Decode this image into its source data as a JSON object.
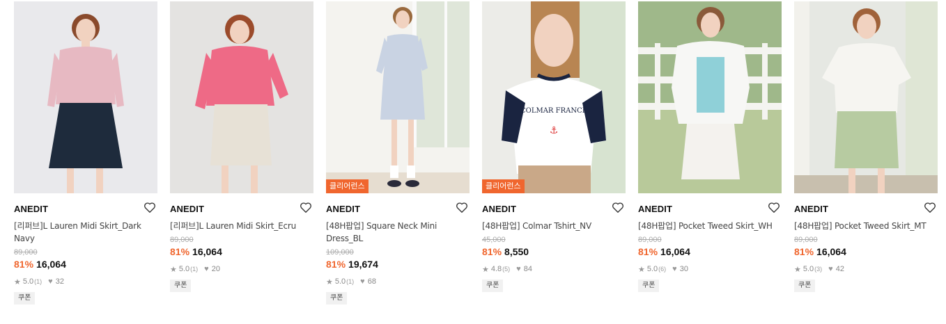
{
  "products": [
    {
      "brand": "ANEDIT",
      "name": "[리퍼브]L Lauren Midi Skirt_Dark Navy",
      "original_price": "89,000",
      "discount": "81%",
      "price": "16,064",
      "rating": "5.0",
      "reviews": "(1)",
      "likes": "32",
      "coupon": "쿠폰",
      "badge": "",
      "colors": {
        "bg": "#e9e9ec",
        "top": "#e7b9c2",
        "bottom": "#1e2b3c"
      }
    },
    {
      "brand": "ANEDIT",
      "name": "[리퍼브]L Lauren Midi Skirt_Ecru",
      "original_price": "89,000",
      "discount": "81%",
      "price": "16,064",
      "rating": "5.0",
      "reviews": "(1)",
      "likes": "20",
      "coupon": "쿠폰",
      "badge": "",
      "colors": {
        "bg": "#e4e3e1",
        "top": "#ee6a86",
        "bottom": "#e7e1d6"
      }
    },
    {
      "brand": "ANEDIT",
      "name": "[48H팝업] Square Neck Mini Dress_BL",
      "original_price": "109,000",
      "discount": "81%",
      "price": "19,674",
      "rating": "5.0",
      "reviews": "(1)",
      "likes": "68",
      "coupon": "쿠폰",
      "badge": "클리어런스",
      "colors": {
        "bg": "#dfe6d9",
        "top": "#c9d3e3",
        "bottom": "#c9d3e3"
      }
    },
    {
      "brand": "ANEDIT",
      "name": "[48H팝업] Colmar Tshirt_NV",
      "original_price": "45,000",
      "discount": "81%",
      "price": "8,550",
      "rating": "4.8",
      "reviews": "(5)",
      "likes": "84",
      "coupon": "쿠폰",
      "badge": "클리어런스",
      "colors": {
        "bg": "#d7e3d0",
        "top": "#ffffff",
        "bottom": "#c9a888"
      }
    },
    {
      "brand": "ANEDIT",
      "name": "[48H팝업] Pocket Tweed Skirt_WH",
      "original_price": "89,000",
      "discount": "81%",
      "price": "16,064",
      "rating": "5.0",
      "reviews": "(6)",
      "likes": "30",
      "coupon": "쿠폰",
      "badge": "",
      "colors": {
        "bg": "#b8c99a",
        "top": "#f7f7f5",
        "bottom": "#f4f2ee"
      }
    },
    {
      "brand": "ANEDIT",
      "name": "[48H팝업] Pocket Tweed Skirt_MT",
      "original_price": "89,000",
      "discount": "81%",
      "price": "16,064",
      "rating": "5.0",
      "reviews": "(3)",
      "likes": "42",
      "coupon": "쿠폰",
      "badge": "",
      "colors": {
        "bg": "#e6e8e3",
        "top": "#f6f5f1",
        "bottom": "#b7cba1"
      }
    }
  ],
  "icons": {
    "wishlist": "heart-outline-icon",
    "rating": "star-icon",
    "likes": "heart-icon"
  }
}
